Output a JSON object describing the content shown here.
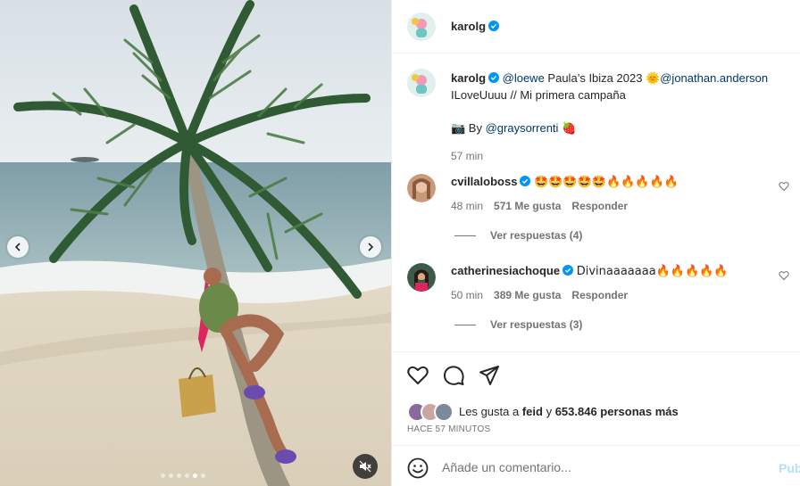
{
  "post": {
    "author": "karolg",
    "verified": true
  },
  "caption": {
    "username": "karolg",
    "mention_loewe": "@loewe",
    "text_1": " Paula’s Ibiza 2023 ",
    "emoji_sun": "🌞",
    "mention_ja": "@jonathan.anderson",
    "text_2": "ILoveUuuu // Mi primera campaña ",
    "emoji_tail": "",
    "photo_emoji": "📷",
    "by_text": " By ",
    "mention_gray": "@graysorrenti",
    "strawberry": "🍓",
    "time": "57 min"
  },
  "comments": [
    {
      "username": "cvillaloboss",
      "verified": true,
      "text": "🤩🤩🤩🤩🤩🔥🔥🔥🔥🔥",
      "time": "48 min",
      "likes": "571 Me gusta",
      "reply": "Responder",
      "view_replies": "Ver respuestas (4)"
    },
    {
      "username": "catherinesiachoque",
      "verified": true,
      "text": "Divinaaaaaaa🔥🔥🔥🔥🔥",
      "time": "50 min",
      "likes": "389 Me gusta",
      "reply": "Responder",
      "view_replies": "Ver respuestas (3)"
    }
  ],
  "likes": {
    "prefix": "Les gusta a ",
    "first_user": "feid",
    "connector": " y ",
    "count": "653.846 personas más"
  },
  "timestamp": "HACE 57 MINUTOS",
  "comment_box": {
    "placeholder": "Añade un comentario...",
    "publish_label": "Pub"
  },
  "icons": {
    "like": "heart-icon",
    "comment": "comment-bubble-icon",
    "share": "paper-plane-icon",
    "emoji": "smile-icon",
    "mute": "speaker-muted-icon",
    "prev": "chevron-left-icon",
    "next": "chevron-right-icon"
  },
  "colors": {
    "verified": "#0095f6",
    "mention": "#00376b",
    "secondary": "#737373",
    "publish_disabled": "#b2dffc"
  }
}
